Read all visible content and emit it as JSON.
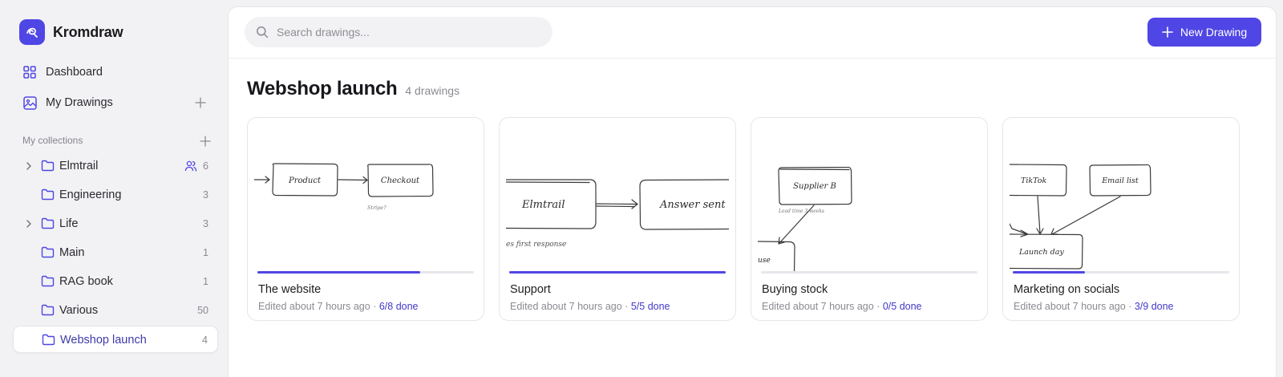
{
  "app": {
    "name": "Kromdraw"
  },
  "nav": [
    {
      "label": "Dashboard",
      "icon": "grid-icon"
    },
    {
      "label": "My Drawings",
      "icon": "image-icon"
    }
  ],
  "collections": {
    "title": "My collections",
    "items": [
      {
        "name": "Elmtrail",
        "count": "6",
        "expandable": true,
        "shared": true
      },
      {
        "name": "Engineering",
        "count": "3",
        "expandable": false,
        "shared": false
      },
      {
        "name": "Life",
        "count": "3",
        "expandable": true,
        "shared": false
      },
      {
        "name": "Main",
        "count": "1",
        "expandable": false,
        "shared": false
      },
      {
        "name": "RAG book",
        "count": "1",
        "expandable": false,
        "shared": false
      },
      {
        "name": "Various",
        "count": "50",
        "expandable": false,
        "shared": false
      },
      {
        "name": "Webshop launch",
        "count": "4",
        "expandable": false,
        "shared": false,
        "active": true
      }
    ]
  },
  "search": {
    "placeholder": "Search drawings..."
  },
  "toolbar": {
    "new_label": "New Drawing"
  },
  "page": {
    "title": "Webshop launch",
    "subtitle": "4 drawings"
  },
  "drawings": [
    {
      "title": "The website",
      "edited": "Edited about 7 hours ago",
      "done": "6/8 done",
      "progress": 0.75,
      "sketch": {
        "box1": "Product",
        "box2": "Checkout",
        "note": "Stripe?"
      }
    },
    {
      "title": "Support",
      "edited": "Edited about 7 hours ago",
      "done": "5/5 done",
      "progress": 1.0,
      "sketch": {
        "box1": "Elmtrail",
        "box2": "Answer sent",
        "note": "es first response"
      }
    },
    {
      "title": "Buying stock",
      "edited": "Edited about 7 hours ago",
      "done": "0/5 done",
      "progress": 0.0,
      "sketch": {
        "box1": "Supplier B",
        "box2": "use",
        "note": "Lead time 3 weeks"
      }
    },
    {
      "title": "Marketing on socials",
      "edited": "Edited about 7 hours ago",
      "done": "3/9 done",
      "progress": 0.333,
      "sketch": {
        "box1": "TikTok",
        "box2": "Email list",
        "box3": "Launch day"
      }
    }
  ],
  "separator": "·",
  "colors": {
    "accent": "#4f46e5",
    "accent_text": "#4338ca",
    "sidebar_bg": "#f2f2f4"
  }
}
